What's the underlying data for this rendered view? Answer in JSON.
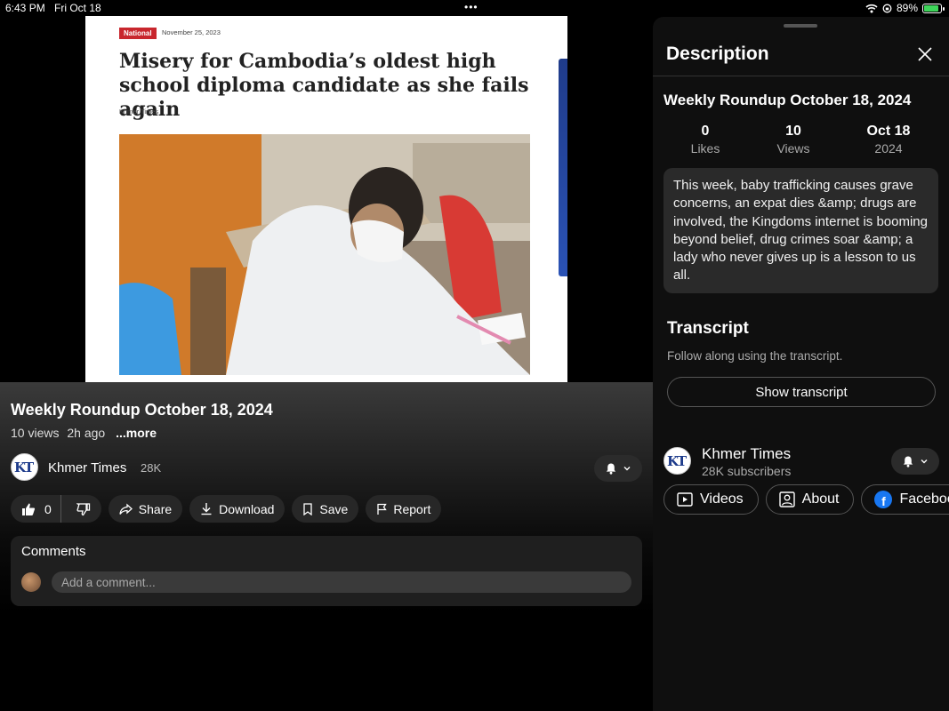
{
  "status_bar": {
    "time": "6:43 PM",
    "date": "Fri Oct 18",
    "multitask": "•••",
    "battery": "89%"
  },
  "video": {
    "article": {
      "category": "National",
      "date": "November 25, 2023",
      "headline": "Misery for Cambodia’s oldest high school diploma candidate as she fails again",
      "source": "Khmer Times"
    },
    "title": "Weekly Roundup October 18, 2024",
    "views": "10 views",
    "age": "2h ago",
    "more_label": "...more"
  },
  "channel": {
    "name": "Khmer Times",
    "subs_short": "28K",
    "subs_full": "28K subscribers",
    "logo": "KT"
  },
  "actions": {
    "likes": "0",
    "share": "Share",
    "download": "Download",
    "save": "Save",
    "report": "Report"
  },
  "comments": {
    "title": "Comments",
    "placeholder": "Add a comment..."
  },
  "description_panel": {
    "title": "Description",
    "video_title": "Weekly Roundup October 18, 2024",
    "stats": [
      {
        "value": "0",
        "label": "Likes"
      },
      {
        "value": "10",
        "label": "Views"
      },
      {
        "value": "Oct 18",
        "label": "2024"
      }
    ],
    "text": "This week, baby trafficking causes grave concerns, an expat dies &amp; drugs are involved, the Kingdoms internet is booming beyond belief, drug crimes soar &amp; a lady who never gives up is a lesson to us all.",
    "transcript_title": "Transcript",
    "transcript_sub": "Follow along using the transcript.",
    "transcript_button": "Show transcript",
    "tabs": {
      "videos": "Videos",
      "about": "About",
      "facebook": "Facebook"
    }
  },
  "colors": {
    "accent_red": "#c8262d",
    "brand_blue": "#1d3b8b",
    "facebook": "#1877f2",
    "panel_bg": "#0f0f0f"
  }
}
